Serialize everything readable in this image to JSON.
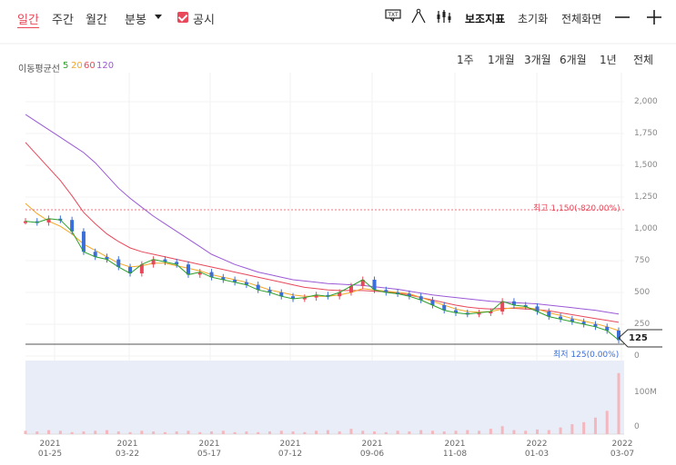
{
  "toolbar": {
    "tabs": [
      "일간",
      "주간",
      "월간",
      "분봉"
    ],
    "disclosure_label": "공시",
    "indicator_label": "보조지표",
    "reset_label": "초기화",
    "fullscreen_label": "전체화면"
  },
  "ma_legend": {
    "label": "이동평균선",
    "periods": [
      "5",
      "20",
      "60",
      "120"
    ],
    "colors": [
      "#2ca02c",
      "#f5a623",
      "#e8485a",
      "#9b59d6"
    ]
  },
  "ranges": [
    "1주",
    "1개월",
    "3개월",
    "6개월",
    "1년",
    "전체"
  ],
  "annotations": {
    "high": "최고 1,150(-820.00%)",
    "low": "최저 125(0.00%)",
    "current_price": "125"
  },
  "chart_data": {
    "type": "candlestick",
    "y_ticks": [
      "2,000",
      "1,750",
      "1,500",
      "1,250",
      "1,000",
      "750",
      "500",
      "250",
      "0"
    ],
    "ylim": [
      0,
      2100
    ],
    "volume_ticks": [
      "100M",
      "0"
    ],
    "x_ticks": [
      {
        "year": "2021",
        "date": "01-25"
      },
      {
        "year": "2021",
        "date": "03-22"
      },
      {
        "year": "2021",
        "date": "05-17"
      },
      {
        "year": "2021",
        "date": "07-12"
      },
      {
        "year": "2021",
        "date": "09-06"
      },
      {
        "year": "2021",
        "date": "11-08"
      },
      {
        "year": "2022",
        "date": "01-03"
      },
      {
        "year": "2022",
        "date": "03-07"
      }
    ],
    "high_value": 1150,
    "low_value": 125,
    "close_series": [
      1060,
      1050,
      1080,
      1070,
      980,
      820,
      780,
      760,
      700,
      650,
      720,
      760,
      740,
      720,
      640,
      660,
      620,
      600,
      580,
      560,
      520,
      500,
      470,
      450,
      460,
      480,
      470,
      500,
      550,
      600,
      520,
      500,
      490,
      470,
      440,
      400,
      360,
      340,
      330,
      340,
      350,
      430,
      400,
      390,
      350,
      310,
      290,
      270,
      250,
      230,
      200,
      125
    ],
    "ma20_series": [
      1200,
      1120,
      1060,
      1020,
      960,
      880,
      830,
      780,
      730,
      700,
      710,
      730,
      730,
      710,
      690,
      670,
      640,
      620,
      600,
      580,
      550,
      520,
      500,
      480,
      470,
      470,
      470,
      480,
      500,
      530,
      520,
      510,
      500,
      490,
      460,
      430,
      400,
      370,
      350,
      345,
      350,
      370,
      380,
      380,
      370,
      340,
      320,
      295,
      275,
      255,
      230,
      200
    ],
    "ma60_series": [
      1680,
      1580,
      1480,
      1380,
      1260,
      1130,
      1040,
      960,
      900,
      850,
      820,
      800,
      780,
      760,
      740,
      720,
      700,
      680,
      660,
      640,
      620,
      600,
      580,
      560,
      540,
      530,
      520,
      515,
      515,
      515,
      510,
      505,
      495,
      480,
      460,
      440,
      420,
      400,
      385,
      375,
      370,
      375,
      375,
      370,
      365,
      355,
      340,
      325,
      310,
      295,
      280,
      265
    ],
    "ma120_series": [
      1900,
      1840,
      1780,
      1720,
      1660,
      1600,
      1520,
      1420,
      1320,
      1240,
      1170,
      1100,
      1040,
      980,
      920,
      860,
      800,
      760,
      720,
      690,
      660,
      640,
      620,
      600,
      590,
      580,
      570,
      565,
      560,
      555,
      545,
      535,
      525,
      510,
      495,
      480,
      470,
      460,
      450,
      440,
      430,
      425,
      420,
      415,
      410,
      400,
      390,
      380,
      370,
      360,
      345,
      330
    ],
    "volume_series": [
      0.05,
      0.04,
      0.06,
      0.05,
      0.03,
      0.04,
      0.05,
      0.06,
      0.04,
      0.03,
      0.05,
      0.04,
      0.03,
      0.04,
      0.05,
      0.03,
      0.04,
      0.05,
      0.03,
      0.04,
      0.03,
      0.04,
      0.05,
      0.04,
      0.03,
      0.05,
      0.06,
      0.04,
      0.08,
      0.05,
      0.04,
      0.03,
      0.05,
      0.04,
      0.06,
      0.05,
      0.04,
      0.05,
      0.06,
      0.05,
      0.08,
      0.12,
      0.06,
      0.05,
      0.07,
      0.06,
      0.1,
      0.15,
      0.18,
      0.25,
      0.35,
      0.92
    ]
  }
}
